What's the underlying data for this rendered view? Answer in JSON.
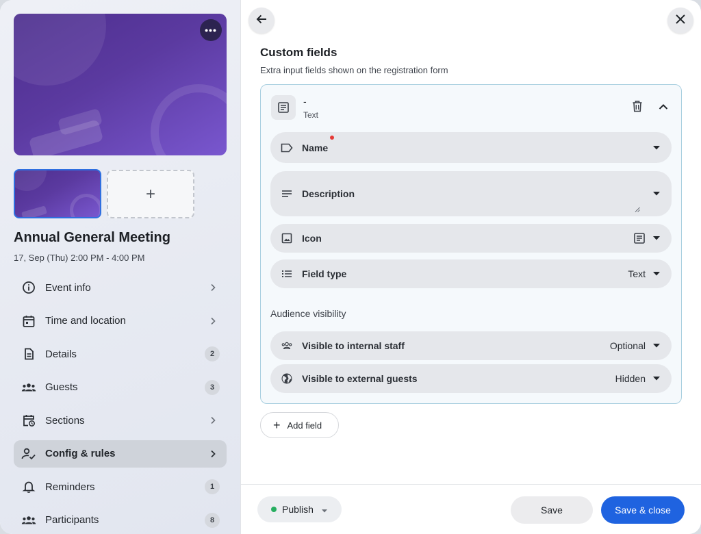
{
  "event": {
    "title": "Annual General Meeting",
    "date": "17, Sep (Thu) 2:00 PM - 4:00 PM",
    "cover_more_icon": "more-horizontal-icon",
    "add_image_label": "+"
  },
  "nav": {
    "items": [
      {
        "label": "Event info",
        "icon": "info-icon",
        "trailing": "chevron"
      },
      {
        "label": "Time and location",
        "icon": "calendar-icon",
        "trailing": "chevron"
      },
      {
        "label": "Details",
        "icon": "document-icon",
        "badge": "2"
      },
      {
        "label": "Guests",
        "icon": "group-icon",
        "badge": "3"
      },
      {
        "label": "Sections",
        "icon": "calendar-clock-icon",
        "trailing": "chevron"
      },
      {
        "label": "Config & rules",
        "icon": "user-check-icon",
        "trailing": "chevron",
        "active": true
      },
      {
        "label": "Reminders",
        "icon": "bell-icon",
        "badge": "1"
      },
      {
        "label": "Participants",
        "icon": "group-icon",
        "badge": "8"
      }
    ]
  },
  "panel": {
    "title": "Custom fields",
    "subtitle": "Extra input fields shown on the registration form",
    "field": {
      "name": "-",
      "type_label": "Text",
      "rows": {
        "name_label": "Name",
        "description_label": "Description",
        "icon_label": "Icon",
        "field_type_label": "Field type",
        "field_type_value": "Text"
      },
      "audience": {
        "heading": "Audience visibility",
        "internal_label": "Visible to internal staff",
        "internal_value": "Optional",
        "external_label": "Visible to external guests",
        "external_value": "Hidden"
      }
    },
    "add_field_label": "Add field"
  },
  "footer": {
    "publish_label": "Publish",
    "publish_status_color": "#27ae60",
    "save_label": "Save",
    "save_close_label": "Save & close",
    "accent_color": "#1f63e0"
  }
}
